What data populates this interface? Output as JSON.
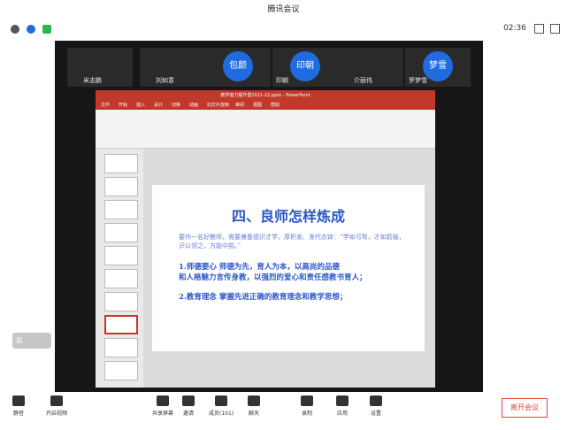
{
  "window": {
    "title": "腾讯会议"
  },
  "topbar": {
    "timer": "02:36"
  },
  "participants": [
    {
      "name": "米志鹏"
    },
    {
      "name": "刘如意"
    },
    {
      "name": "包颜",
      "avatar_text": "包颜"
    },
    {
      "name": "印朝",
      "avatar_text": "印朝"
    },
    {
      "name": "介丽伟"
    },
    {
      "name": "罗梦雪",
      "avatar_text": "梦雪"
    }
  ],
  "powerpoint": {
    "window_title": "教学能力提升暨2021-22.pptx - PowerPoint",
    "tabs": [
      "文件",
      "开始",
      "插入",
      "设计",
      "切换",
      "动画",
      "幻灯片放映",
      "审阅",
      "视图",
      "帮助"
    ]
  },
  "slide": {
    "heading": "四、良师怎样炼成",
    "paragraph": "要作一名好教师，需要兼备德识才学，厚积发、渐代衣钵：“学如弓弩，才如箭镞，识以领之，方能中鹄。”",
    "point1a": "1.师德要心 师德为先，育人为本，以高尚的品德",
    "point1b": "和人格魅力言传身教，以强烈的爱心和责任感教书育人；",
    "point2": "2.教育理念 掌握先进正确的教育理念和教学思想；"
  },
  "status_chip": {
    "label": "调"
  },
  "bottombar": {
    "mute": "静音",
    "video": "开启视频",
    "share": "共享屏幕",
    "invite": "邀请",
    "members": "成员(101)",
    "chat": "聊天",
    "record": "录制",
    "apps": "应用",
    "settings": "设置",
    "leave": "离开会议"
  },
  "colors": {
    "accent": "#2b57c8",
    "ppt_red": "#c0392b",
    "leave_red": "#e1473d"
  }
}
